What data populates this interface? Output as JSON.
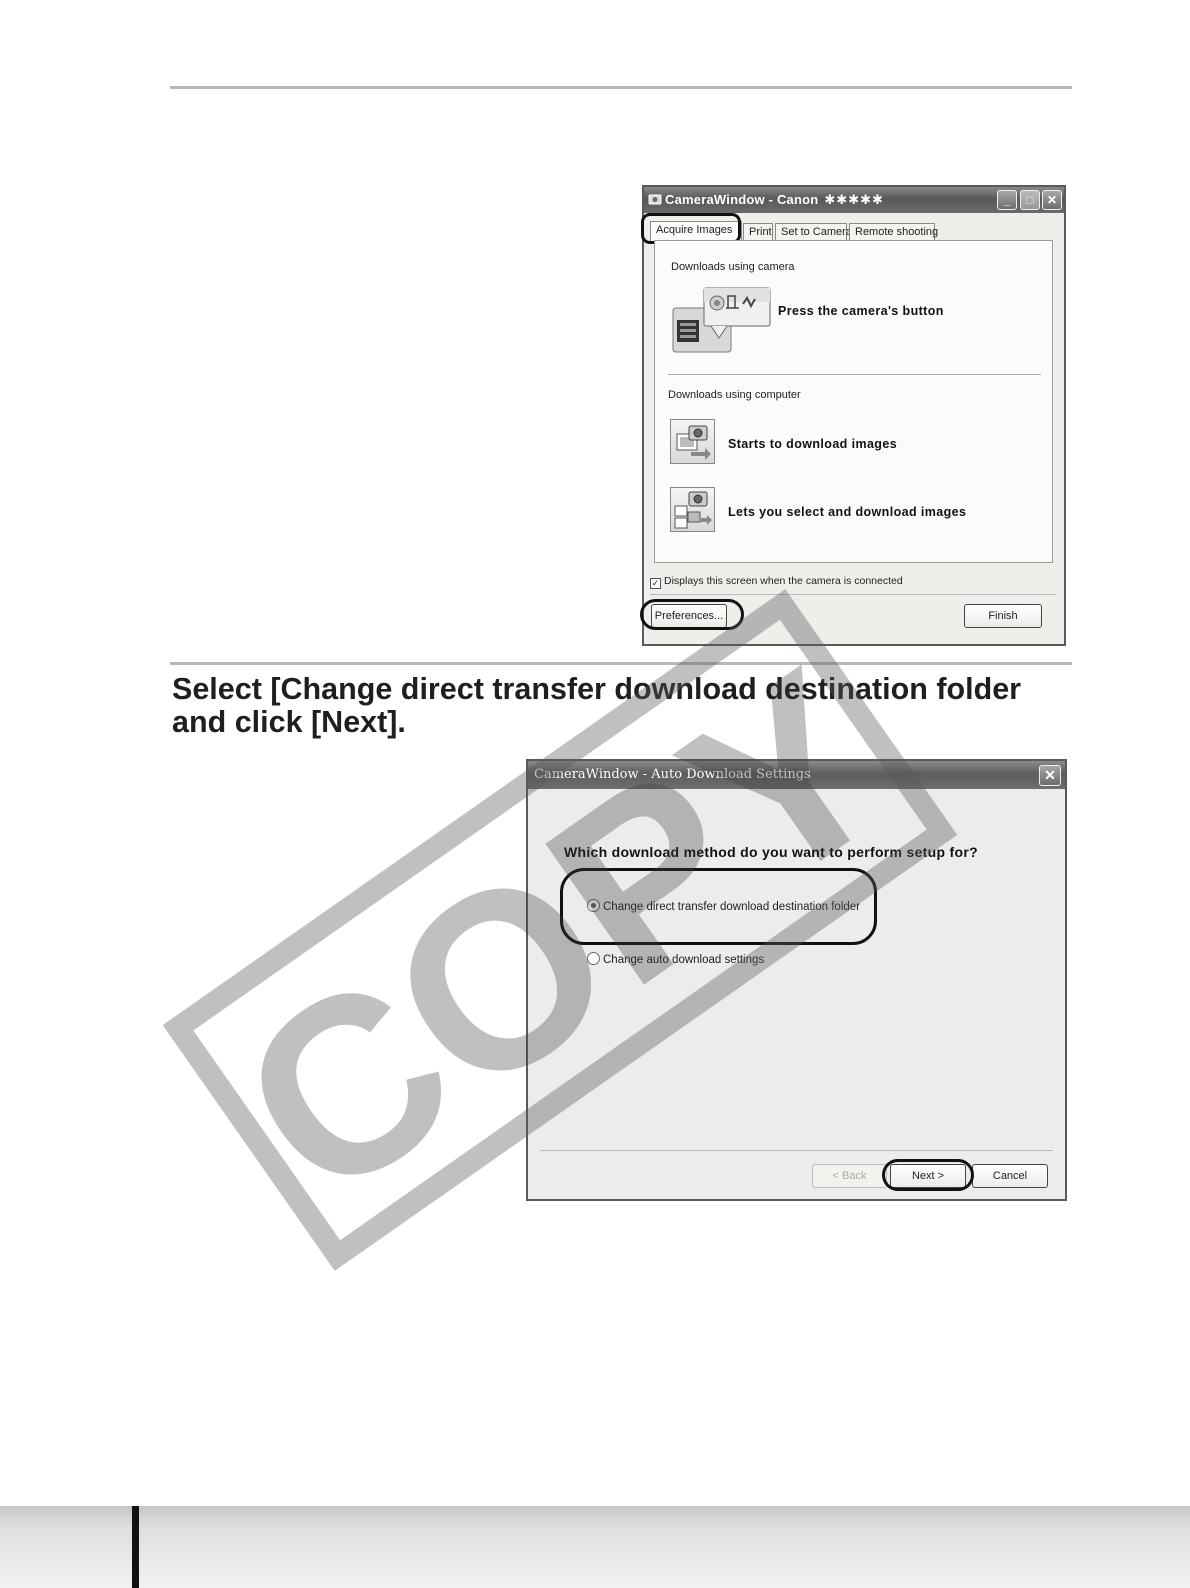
{
  "window1": {
    "title": "CameraWindow - Canon",
    "title_suffix": "✱✱✱✱✱",
    "tabs": [
      "Acquire Images",
      "Print",
      "Set to Camera",
      "Remote shooting"
    ],
    "section_camera_label": "Downloads using camera",
    "camera_action": "Press the camera's button",
    "section_computer_label": "Downloads using computer",
    "action_start": "Starts to download images",
    "action_select": "Lets you select and download images",
    "checkbox_label": "Displays this screen when the camera is connected",
    "checkbox_checked": true,
    "preferences_button": "Preferences...",
    "finish_button": "Finish"
  },
  "step_heading": "Select [Change direct transfer download destination folder and click [Next].",
  "window2": {
    "title": "CameraWindow - Auto Download Settings",
    "question": "Which download method do you want to perform setup for?",
    "option_1": "Change direct transfer download destination folder",
    "option_1_selected": true,
    "option_2": "Change auto download settings",
    "back_button": "< Back",
    "next_button": "Next >",
    "cancel_button": "Cancel"
  },
  "watermark": "COPY"
}
